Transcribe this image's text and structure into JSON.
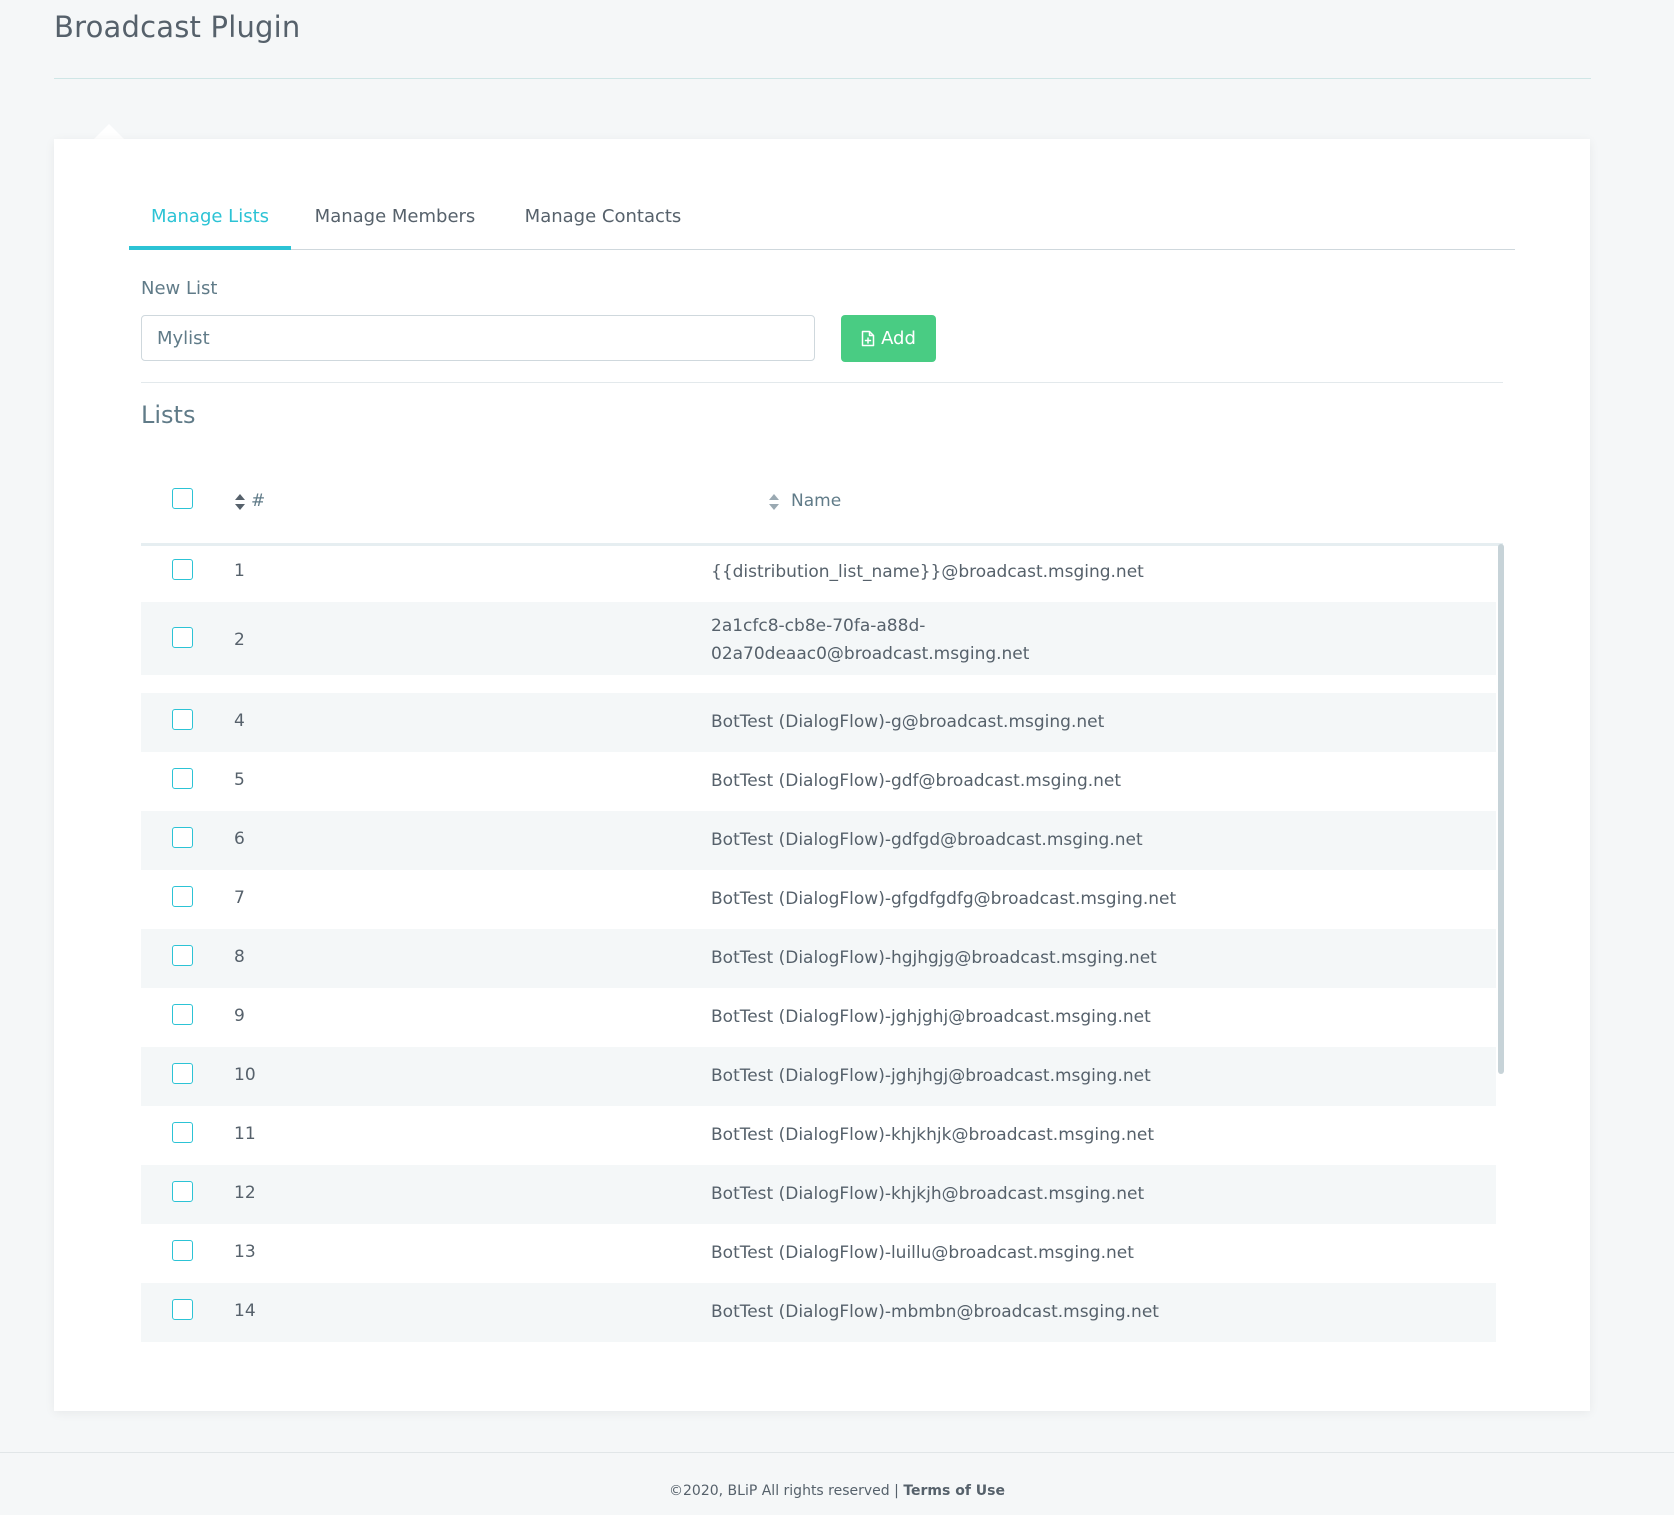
{
  "page": {
    "title": "Broadcast Plugin"
  },
  "tabs": [
    {
      "label": "Manage Lists",
      "active": true
    },
    {
      "label": "Manage Members",
      "active": false
    },
    {
      "label": "Manage Contacts",
      "active": false
    }
  ],
  "new_list": {
    "label": "New List",
    "input_value": "Mylist",
    "add_label": "Add"
  },
  "lists": {
    "title": "Lists",
    "columns": {
      "number": "#",
      "name": "Name"
    },
    "rows": [
      {
        "num": "1",
        "name": "{{distribution_list_name}}@broadcast.msging.net"
      },
      {
        "num": "2",
        "name_line1": "2a1cfc8-cb8e-70fa-a88d-",
        "name_line2": "02a70deaac0@broadcast.msging.net"
      },
      {
        "num": "4",
        "name": "BotTest (DialogFlow)-g@broadcast.msging.net"
      },
      {
        "num": "5",
        "name": "BotTest (DialogFlow)-gdf@broadcast.msging.net"
      },
      {
        "num": "6",
        "name": "BotTest (DialogFlow)-gdfgd@broadcast.msging.net"
      },
      {
        "num": "7",
        "name": "BotTest (DialogFlow)-gfgdfgdfg@broadcast.msging.net"
      },
      {
        "num": "8",
        "name": "BotTest (DialogFlow)-hgjhgjg@broadcast.msging.net"
      },
      {
        "num": "9",
        "name": "BotTest (DialogFlow)-jghjghj@broadcast.msging.net"
      },
      {
        "num": "10",
        "name": "BotTest (DialogFlow)-jghjhgj@broadcast.msging.net"
      },
      {
        "num": "11",
        "name": "BotTest (DialogFlow)-khjkhjk@broadcast.msging.net"
      },
      {
        "num": "12",
        "name": "BotTest (DialogFlow)-khjkjh@broadcast.msging.net"
      },
      {
        "num": "13",
        "name": "BotTest (DialogFlow)-luillu@broadcast.msging.net"
      },
      {
        "num": "14",
        "name": "BotTest (DialogFlow)-mbmbn@broadcast.msging.net"
      }
    ]
  },
  "footer": {
    "copyright": "©2020, BLiP All rights reserved |",
    "terms_link": "Terms of Use"
  },
  "colors": {
    "accent": "#2cc3d5",
    "button_green": "#49cc83",
    "text": "#56616b",
    "background": "#f5f7f8"
  }
}
